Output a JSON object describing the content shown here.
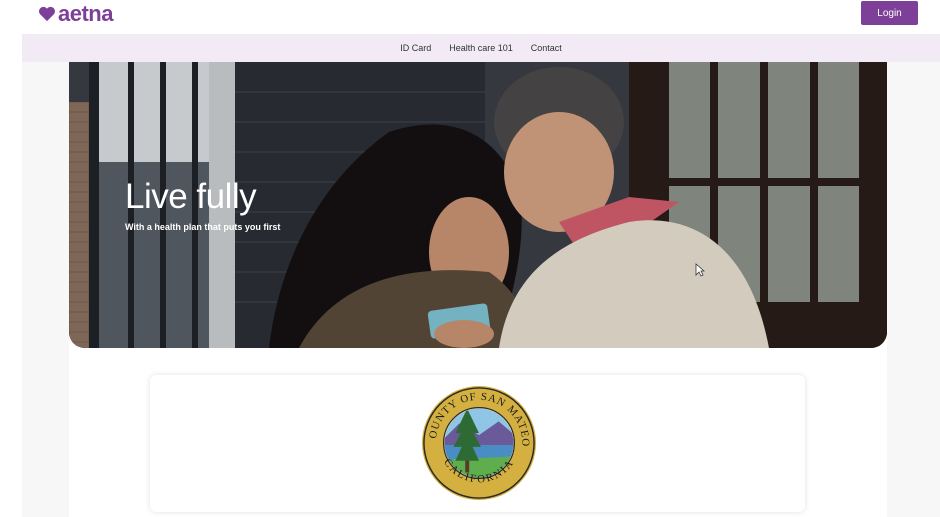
{
  "header": {
    "logo_text": "aetna",
    "login_label": "Login"
  },
  "nav": {
    "items": [
      {
        "label": "ID Card"
      },
      {
        "label": "Health care 101"
      },
      {
        "label": "Contact"
      }
    ]
  },
  "hero": {
    "title": "Live fully",
    "subtitle": "With a health plan that puts you first"
  },
  "seal": {
    "top_text": "COUNTY OF SAN MATEO",
    "bottom_text": "CALIFORNIA"
  },
  "colors": {
    "brand_purple": "#7d3f98",
    "nav_bg": "#f2ebf5",
    "seal_gold": "#d4b040"
  }
}
